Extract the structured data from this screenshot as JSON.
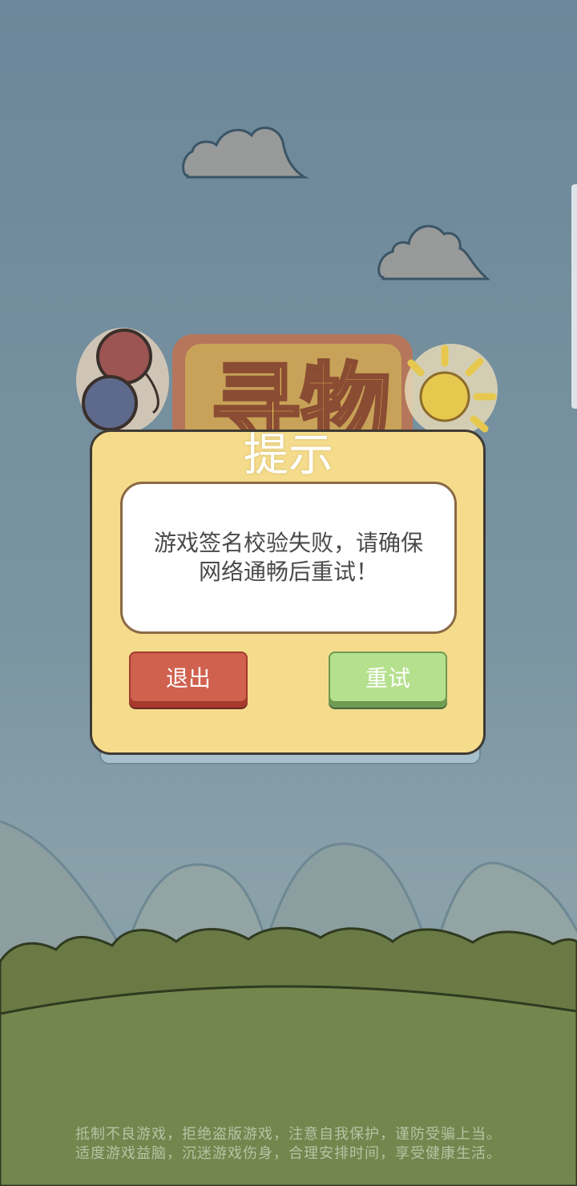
{
  "game": {
    "logo_text": "寻物"
  },
  "dialog": {
    "title": "提示",
    "message": "游戏签名校验失败，请确保网络通畅后重试！",
    "exit_label": "退出",
    "retry_label": "重试"
  },
  "notice": {
    "line1": "抵制不良游戏，拒绝盗版游戏，注意自我保护，谨防受骗上当。",
    "line2": "适度游戏益脑，沉迷游戏伤身，合理安排时间，享受健康生活。"
  },
  "colors": {
    "dialog_bg": "#f4dc8c",
    "exit_button": "#d0614f",
    "retry_button": "#b5e08d",
    "sky": "#6b8799",
    "grass": "#73864e"
  }
}
